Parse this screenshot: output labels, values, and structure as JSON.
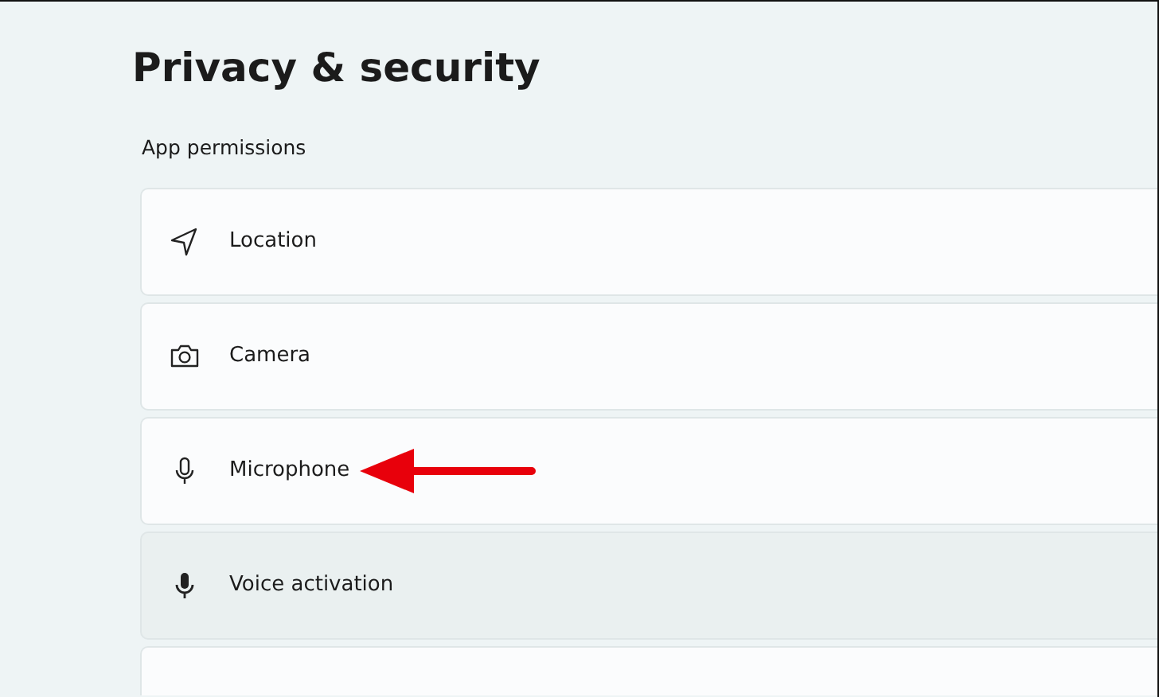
{
  "page_title": "Privacy & security",
  "section_title": "App permissions",
  "items": [
    {
      "kind": "setting",
      "label": "Location",
      "highlighted": false,
      "pointer_arrow": false
    },
    {
      "kind": "setting",
      "label": "Camera",
      "highlighted": false,
      "pointer_arrow": false
    },
    {
      "kind": "setting",
      "label": "Microphone",
      "highlighted": false,
      "pointer_arrow": true
    },
    {
      "kind": "setting",
      "label": "Voice activation",
      "highlighted": true,
      "pointer_arrow": false
    },
    {
      "kind": "blank"
    }
  ]
}
